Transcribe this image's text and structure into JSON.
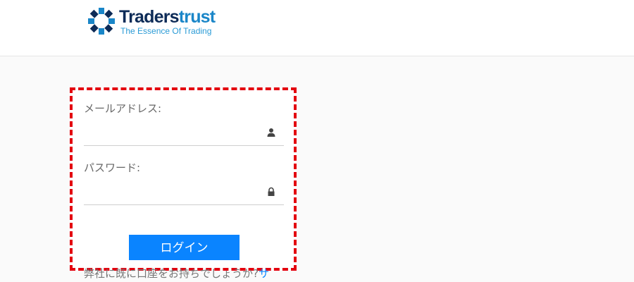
{
  "brand": {
    "name_part1": "Traders",
    "name_part2": "trust",
    "tagline": "The Essence Of Trading"
  },
  "login_form": {
    "email_label": "メールアドレス:",
    "email_value": "",
    "email_icon": "user-icon",
    "password_label": "パスワード:",
    "password_value": "",
    "password_icon": "lock-icon",
    "submit_label": "ログイン"
  },
  "footer_prompt": {
    "text": "弊社に既に口座をお持ちでしょうか?",
    "link_text": "サ"
  },
  "colors": {
    "highlight_border": "#e3000f",
    "button_bg": "#0a84ff",
    "brand_dark": "#0d2b57",
    "brand_light": "#1a86c8"
  }
}
